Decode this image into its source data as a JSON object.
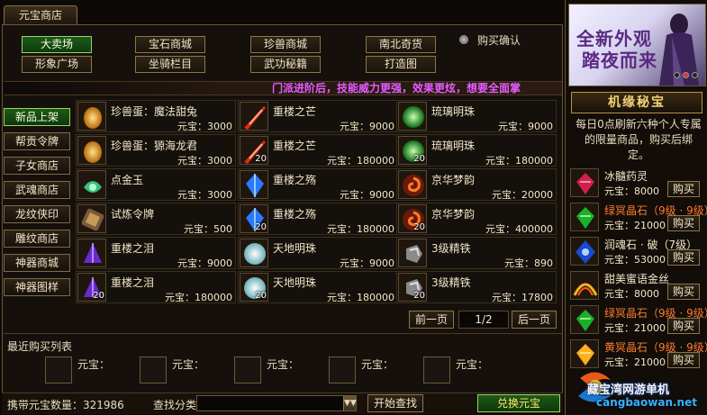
{
  "header": {
    "tab": "元宝商店"
  },
  "categories": [
    {
      "label": "大卖场",
      "active": true
    },
    {
      "label": "宝石商城",
      "active": false
    },
    {
      "label": "珍兽商城",
      "active": false
    },
    {
      "label": "南北奇货",
      "active": false
    },
    {
      "label": "形象广场",
      "active": false
    },
    {
      "label": "坐骑栏目",
      "active": false
    },
    {
      "label": "武功秘籍",
      "active": false
    },
    {
      "label": "打造图",
      "active": false
    }
  ],
  "purchase_confirm": {
    "label": "购买确认"
  },
  "banner": {
    "text": "门派进阶后，技能威力更强，效果更炫，想要全面掌"
  },
  "sidebar": [
    {
      "label": "新品上架",
      "active": true
    },
    {
      "label": "帮贡令牌",
      "active": false
    },
    {
      "label": "子女商店",
      "active": false
    },
    {
      "label": "武魂商店",
      "active": false
    },
    {
      "label": "龙纹侠印",
      "active": false
    },
    {
      "label": "雕纹商店",
      "active": false
    },
    {
      "label": "神器商城",
      "active": false
    },
    {
      "label": "神器图样",
      "active": false
    }
  ],
  "items": [
    {
      "name": "珍兽蛋：魔法甜兔",
      "price": "元宝：3000",
      "count": "",
      "icon": "egg-icon"
    },
    {
      "name": "重楼之芒",
      "price": "元宝：9000",
      "count": "",
      "icon": "red-blade-icon"
    },
    {
      "name": "琉璃明珠",
      "price": "元宝：9000",
      "count": "",
      "icon": "green-pearl-icon"
    },
    {
      "name": "珍兽蛋：獂海龙君",
      "price": "元宝：3000",
      "count": "",
      "icon": "egg-icon"
    },
    {
      "name": "重楼之芒",
      "price": "元宝：180000",
      "count": "20",
      "icon": "red-blade-icon"
    },
    {
      "name": "琉璃明珠",
      "price": "元宝：180000",
      "count": "20",
      "icon": "green-pearl-icon"
    },
    {
      "name": "点金玉",
      "price": "元宝：3000",
      "count": "",
      "icon": "jade-icon"
    },
    {
      "name": "重楼之殇",
      "price": "元宝：9000",
      "count": "",
      "icon": "blue-crystal-icon"
    },
    {
      "name": "京华梦韵",
      "price": "元宝：20000",
      "count": "",
      "icon": "swirl-icon"
    },
    {
      "name": "试炼令牌",
      "price": "元宝：500",
      "count": "",
      "icon": "token-icon"
    },
    {
      "name": "重楼之殇",
      "price": "元宝：180000",
      "count": "20",
      "icon": "blue-crystal-icon"
    },
    {
      "name": "京华梦韵",
      "price": "元宝：400000",
      "count": "20",
      "icon": "swirl-icon"
    },
    {
      "name": "重楼之泪",
      "price": "元宝：9000",
      "count": "",
      "icon": "purple-shard-icon"
    },
    {
      "name": "天地明珠",
      "price": "元宝：9000",
      "count": "",
      "icon": "white-pearl-icon"
    },
    {
      "name": "3级精铁",
      "price": "元宝：890",
      "count": "",
      "icon": "iron-icon"
    },
    {
      "name": "重楼之泪",
      "price": "元宝：180000",
      "count": "20",
      "icon": "purple-shard-icon"
    },
    {
      "name": "天地明珠",
      "price": "元宝：180000",
      "count": "20",
      "icon": "white-pearl-icon"
    },
    {
      "name": "3级精铁",
      "price": "元宝：17800",
      "count": "20",
      "icon": "iron-icon"
    }
  ],
  "pager": {
    "prev": "前一页",
    "page": "1/2",
    "next": "后一页"
  },
  "recent": {
    "title": "最近购买列表",
    "slots": [
      "元宝：",
      "元宝：",
      "元宝：",
      "元宝：",
      "元宝："
    ]
  },
  "bottom": {
    "balance": "携带元宝数量：321986",
    "filter_label": "查找分类",
    "search": "开始查找",
    "exchange": "兑换元宝"
  },
  "ad": {
    "line1": "全新外观",
    "line2": "踏夜而来"
  },
  "special": {
    "title": "机缘秘宝",
    "desc": "每日0点刷新六种个人专属的限量商品，购买后绑定。",
    "items": [
      {
        "name": "冰髓药灵",
        "price": "元宝：8000",
        "buy": "购买",
        "color": "#f2e6c8",
        "icon": "red-gem-icon"
      },
      {
        "name": "绿冥晶石（9级 · 9级）",
        "price": "元宝：21000",
        "buy": "购买",
        "color": "#ff7a2e",
        "icon": "green-gem-icon"
      },
      {
        "name": "润魂石 · 破（7级）",
        "price": "元宝：53000",
        "buy": "购买",
        "color": "#f2e6c8",
        "icon": "blue-gem-icon"
      },
      {
        "name": "甜美蜜语金丝",
        "price": "元宝：8000",
        "buy": "购买",
        "color": "#f2e6c8",
        "icon": "gold-thread-icon"
      },
      {
        "name": "绿冥晶石（9级 · 9级）",
        "price": "元宝：21000",
        "buy": "购买",
        "color": "#ff7a2e",
        "icon": "green-gem-icon"
      },
      {
        "name": "黄冥晶石（9级 · 9级）",
        "price": "元宝：21000",
        "buy": "购买",
        "color": "#ff7a2e",
        "icon": "yellow-gem-icon"
      }
    ]
  },
  "watermark": {
    "text": "藏宝湾网游单机",
    "url": "cangbaowan.net"
  }
}
